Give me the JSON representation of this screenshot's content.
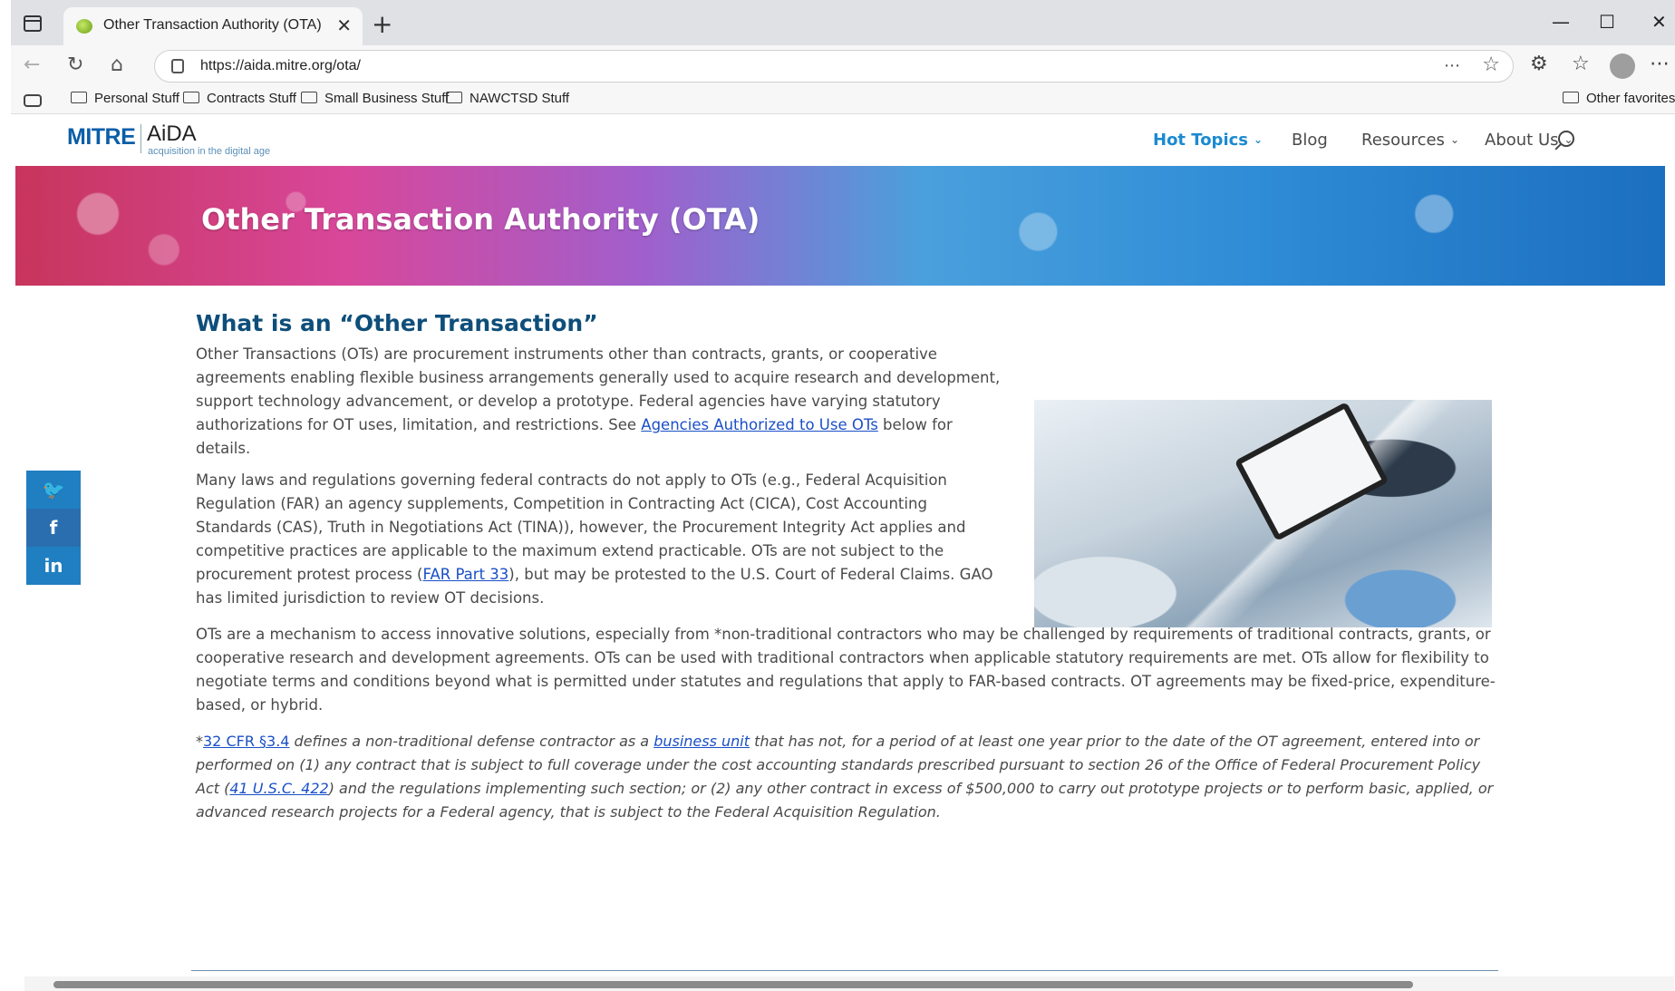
{
  "browser": {
    "tab_title": "Other Transaction Authority (OTA)",
    "tab_close": "✕",
    "new_tab": "+",
    "url": "https://aida.mitre.org/ota/",
    "win_minimize": "—",
    "win_maximize": "☐",
    "win_close": "✕",
    "omni_more": "⋯",
    "omni_star": "☆",
    "nav_back": "←",
    "nav_reload": "↻",
    "nav_home": "⌂",
    "extensions": "⚙",
    "favorites": "☆",
    "menu": "⋯"
  },
  "bookmarks": [
    "Personal Stuff",
    "Contracts Stuff",
    "Small Business Stuff",
    "NAWCTSD Stuff"
  ],
  "bookmarks_other": "Other favorites",
  "site": {
    "logo_mitre": "MITRE",
    "logo_aida": "AiDA",
    "logo_tagline": "acquisition in the digital age",
    "nav": [
      {
        "label": "Hot Topics",
        "chevron": "⌄"
      },
      {
        "label": "Blog"
      },
      {
        "label": "Resources",
        "chevron": "⌄"
      },
      {
        "label": "About Us",
        "chevron": "⌄"
      }
    ]
  },
  "hero": {
    "title": "Other Transaction Authority (OTA)"
  },
  "social": {
    "twitter": "🐦",
    "facebook": "f",
    "linkedin": "in"
  },
  "content": {
    "heading": "What is an “Other Transaction”",
    "p1_a": "Other Transactions (OTs) are procurement instruments other than contracts, grants, or cooperative agreements enabling flexible business arrangements generally used to acquire research and development, support technology advancement, or develop a prototype. Federal agencies have varying statutory authorizations for OT uses, limitation, and restrictions. See ",
    "p1_link": "Agencies Authorized to Use OTs",
    "p1_b": " below for details.",
    "p2_a": "Many laws and regulations governing federal contracts do not apply to OTs (e.g., Federal Acquisition Regulation (FAR) an agency supplements, Competition in Contracting Act (CICA), Cost Accounting Standards (CAS), Truth in Negotiations Act (TINA)), however, the Procurement Integrity Act applies and competitive practices are applicable to the maximum extend practicable. OTs are not subject to the procurement protest process (",
    "p2_link": "FAR Part 33",
    "p2_b": "), but may be protested to the U.S. Court of Federal Claims. GAO has limited jurisdiction to review OT decisions.",
    "p3": "OTs are a mechanism to access innovative solutions, especially from *non-traditional contractors who may be challenged by requirements of traditional contracts, grants, or cooperative research and development agreements. OTs can be used with traditional contractors when applicable statutory requirements are met. OTs allow for flexibility to negotiate terms and conditions beyond what is permitted under statutes and regulations that apply to FAR-based contracts. OT agreements may be fixed-price, expenditure-based, or hybrid.",
    "fn_star": "*",
    "fn_link1": "32 CFR §3.4",
    "fn_a": " defines a non-traditional defense contractor as a ",
    "fn_link2": "business unit",
    "fn_b": " that has not, for a period of at least one year prior to the date of the OT agreement, entered into or performed on (1)  any contract that is subject to full coverage under the cost accounting standards prescribed pursuant to section 26 of the Office of Federal Procurement Policy Act (",
    "fn_link3": "41 U.S.C. 422",
    "fn_c": ") and the regulations implementing such section; or (2) any other contract in excess of $500,000 to carry out prototype projects or to perform basic, applied, or advanced research projects for a Federal agency, that is subject to the Federal Acquisition Regulation."
  },
  "colors": {
    "accent": "#1b8ad0",
    "heading": "#0e4e7a",
    "link": "#1a4fc7",
    "social": "#1f7fc1"
  }
}
